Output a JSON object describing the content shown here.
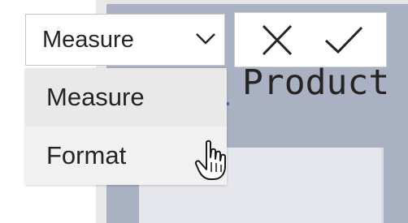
{
  "dropdown": {
    "selected": "Measure",
    "options": [
      "Measure",
      "Format"
    ]
  },
  "canvas": {
    "title_fragment": "Product"
  },
  "formula_bar": {
    "cancel_icon": "close-icon",
    "commit_icon": "checkmark-icon"
  },
  "colors": {
    "canvas_background": "#a9b1c3",
    "dropdown_hover": "#e9e9e9"
  }
}
